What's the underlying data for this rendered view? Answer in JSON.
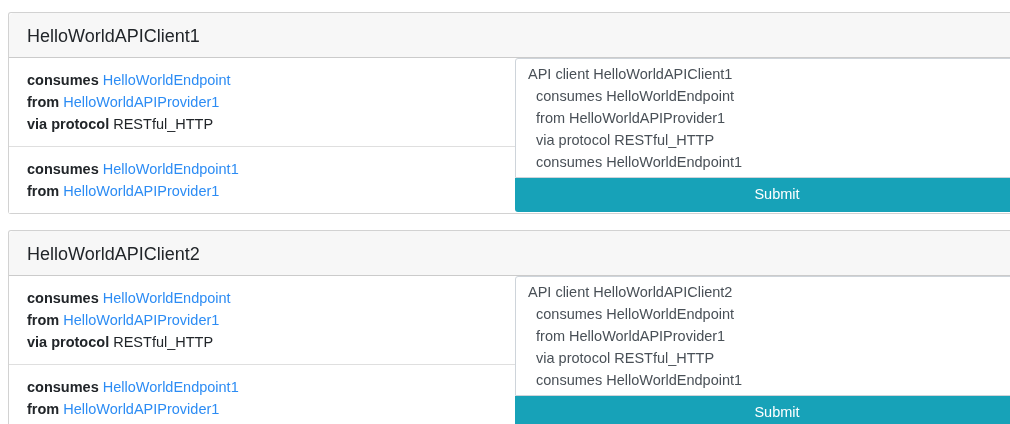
{
  "clients": [
    {
      "title": "HelloWorldAPIClient1",
      "relations": [
        {
          "lines": [
            {
              "label": "consumes",
              "value": "HelloWorldEndpoint",
              "kind": "link"
            },
            {
              "label": "from",
              "value": "HelloWorldAPIProvider1",
              "kind": "link"
            },
            {
              "label": "via protocol",
              "value": "RESTful_HTTP",
              "kind": "plain"
            }
          ]
        },
        {
          "lines": [
            {
              "label": "consumes",
              "value": "HelloWorldEndpoint1",
              "kind": "link"
            },
            {
              "label": "from",
              "value": "HelloWorldAPIProvider1",
              "kind": "link"
            }
          ]
        }
      ],
      "editor": {
        "heading": "API client HelloWorldAPIClient1",
        "lines": [
          "consumes HelloWorldEndpoint",
          "from HelloWorldAPIProvider1",
          "via protocol RESTful_HTTP",
          "consumes HelloWorldEndpoint1"
        ]
      },
      "submit": "Submit"
    },
    {
      "title": "HelloWorldAPIClient2",
      "relations": [
        {
          "lines": [
            {
              "label": "consumes",
              "value": "HelloWorldEndpoint",
              "kind": "link"
            },
            {
              "label": "from",
              "value": "HelloWorldAPIProvider1",
              "kind": "link"
            },
            {
              "label": "via protocol",
              "value": "RESTful_HTTP",
              "kind": "plain"
            }
          ]
        },
        {
          "lines": [
            {
              "label": "consumes",
              "value": "HelloWorldEndpoint1",
              "kind": "link"
            },
            {
              "label": "from",
              "value": "HelloWorldAPIProvider1",
              "kind": "link"
            }
          ]
        }
      ],
      "editor": {
        "heading": "API client HelloWorldAPIClient2",
        "lines": [
          "consumes HelloWorldEndpoint",
          "from HelloWorldAPIProvider1",
          "via protocol RESTful_HTTP",
          "consumes HelloWorldEndpoint1"
        ]
      },
      "submit": "Submit"
    }
  ]
}
